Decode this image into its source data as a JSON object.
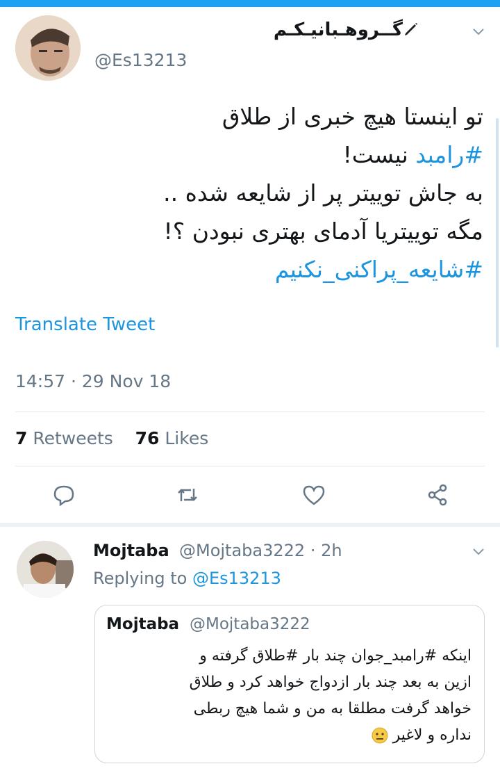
{
  "tweet": {
    "display_name": "گــروهـبانیـکـم",
    "handle": "@Es13213",
    "body_lines": [
      {
        "text": "تو اینستا هیچ خبری از طلاق",
        "hashtag": ""
      },
      {
        "text": " نیست!",
        "hashtag": "#رامبد"
      },
      {
        "text": "به جاش توییتر پر از شایعه شده ..",
        "hashtag": ""
      },
      {
        "text": "مگه توییتریا آدمای بهتری نبودن ؟!",
        "hashtag": ""
      },
      {
        "text": "",
        "hashtag": "#شایعه_پراکنی_نکنیم"
      }
    ],
    "translate_label": "Translate Tweet",
    "timestamp": "14:57 · 29 Nov 18",
    "retweets_count": "7",
    "retweets_label": "Retweets",
    "likes_count": "76",
    "likes_label": "Likes"
  },
  "reply": {
    "display_name": "Mojtaba",
    "handle_time": "@Mojtaba3222 · 2h",
    "replying_prefix": "Replying to ",
    "replying_handle": "@Es13213",
    "quote": {
      "display_name": "Mojtaba",
      "handle": "@Mojtaba3222",
      "lines": [
        "اینکه #رامبد_جوان چند بار #طلاق گرفته و",
        "ازین به بعد چند بار ازدواج خواهد کرد و طلاق",
        "خواهد گرفت مطلقا به من و شما هیچ ربطی",
        "نداره و لاغیر"
      ]
    }
  },
  "colors": {
    "accent": "#1da1f2",
    "link": "#1b95e0",
    "muted": "#657786"
  },
  "icons": [
    "pen-icon",
    "chevron-down-icon",
    "reply-icon",
    "retweet-icon",
    "like-icon",
    "share-icon",
    "neutral-face-emoji"
  ]
}
